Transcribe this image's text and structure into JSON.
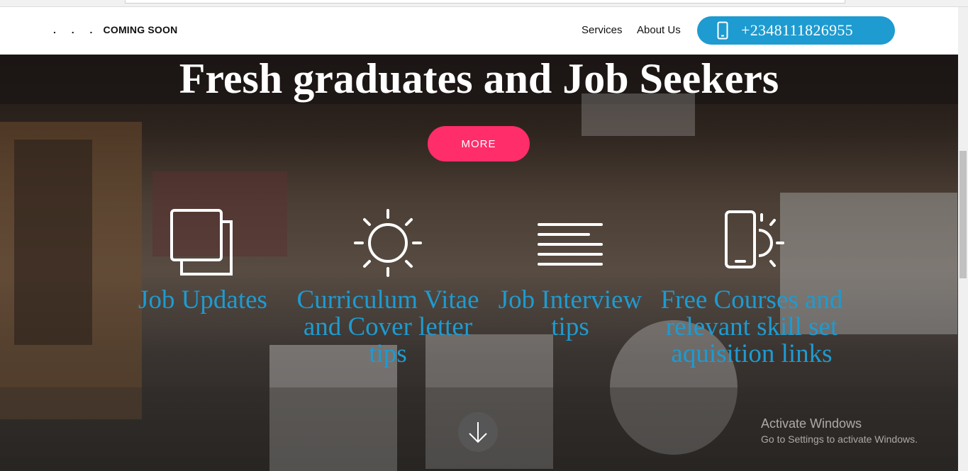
{
  "header": {
    "brand_dots": ". . .",
    "brand_text": "COMING SOON",
    "nav": [
      "Services",
      "About Us"
    ],
    "phone": "+2348111826955",
    "phone_icon": "mobile-phone-icon"
  },
  "hero": {
    "title": "Fresh graduates and Job Seekers",
    "more_button": "MORE",
    "features": [
      {
        "icon": "documents-icon",
        "label": "Job Updates"
      },
      {
        "icon": "sun-icon",
        "label": "Curriculum Vitae and Cover letter tips"
      },
      {
        "icon": "text-lines-icon",
        "label": "Job Interview tips"
      },
      {
        "icon": "phone-sun-icon",
        "label": "Free Courses and relevant skill set aquisition links"
      }
    ],
    "scroll_icon": "arrow-down-icon"
  },
  "watermark": {
    "line1": "Activate Windows",
    "line2": "Go to Settings to activate Windows."
  },
  "colors": {
    "accent_blue": "#1e9bd0",
    "more_pink": "#ff2d6a"
  }
}
